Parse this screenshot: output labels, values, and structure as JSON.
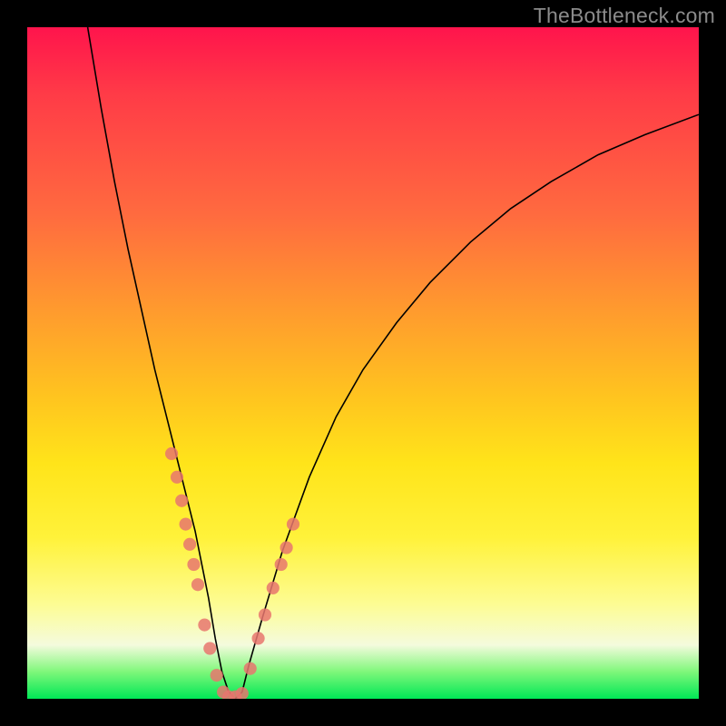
{
  "watermark": "TheBottleneck.com",
  "chart_data": {
    "type": "line",
    "title": "",
    "xlabel": "",
    "ylabel": "",
    "xlim": [
      0,
      100
    ],
    "ylim": [
      0,
      100
    ],
    "background_gradient": {
      "top": "#ff144c",
      "mid": "#ffc41f",
      "bottom": "#00e756"
    },
    "series": [
      {
        "name": "bottleneck-curve",
        "type": "line",
        "color": "#000000",
        "x": [
          9,
          11,
          13,
          15,
          17,
          19,
          21,
          23,
          24,
          25,
          26,
          27,
          28,
          29,
          30,
          31,
          32,
          33,
          35,
          38,
          42,
          46,
          50,
          55,
          60,
          66,
          72,
          78,
          85,
          92,
          100
        ],
        "y": [
          100,
          88,
          77,
          67,
          58,
          49,
          41,
          33,
          29,
          25,
          20,
          15,
          9,
          4,
          1,
          0,
          1,
          5,
          12,
          22,
          33,
          42,
          49,
          56,
          62,
          68,
          73,
          77,
          81,
          84,
          87
        ]
      },
      {
        "name": "highlight-dots",
        "type": "scatter",
        "color": "#e8766e",
        "x": [
          21.5,
          22.3,
          23.0,
          23.6,
          24.2,
          24.8,
          25.4,
          26.4,
          27.2,
          28.2,
          29.2,
          30.0,
          31.0,
          32.0,
          33.2,
          34.4,
          35.4,
          36.6,
          37.8,
          38.6,
          39.6
        ],
        "y": [
          36.5,
          33.0,
          29.5,
          26.0,
          23.0,
          20.0,
          17.0,
          11.0,
          7.5,
          3.5,
          1.0,
          0.3,
          0.3,
          0.8,
          4.5,
          9.0,
          12.5,
          16.5,
          20.0,
          22.5,
          26.0
        ]
      }
    ]
  }
}
